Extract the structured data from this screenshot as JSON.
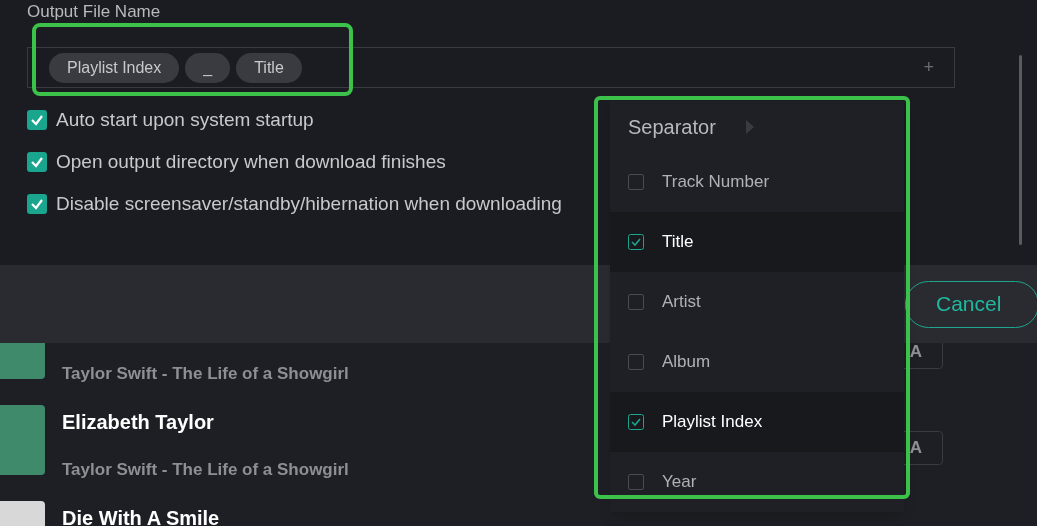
{
  "output_file_name": {
    "label": "Output File Name",
    "chips": [
      "Playlist Index",
      "_",
      "Title"
    ],
    "add_button": "+"
  },
  "options": [
    {
      "label": "Auto start upon system startup",
      "checked": true
    },
    {
      "label": "Open output directory when download finishes",
      "checked": true
    },
    {
      "label": "Disable screensaver/standby/hibernation when downloading",
      "checked": true
    }
  ],
  "cancel_button": "Cancel",
  "tracks": [
    {
      "subtitle": "Taylor Swift - The Life of a Showgirl",
      "action": "A"
    },
    {
      "title": "Elizabeth Taylor",
      "subtitle": "Taylor Swift - The Life of a Showgirl",
      "action": "A"
    },
    {
      "title": "Die With A Smile"
    }
  ],
  "dropdown": {
    "header": "Separator",
    "items": [
      {
        "label": "Track Number",
        "checked": false
      },
      {
        "label": "Title",
        "checked": true
      },
      {
        "label": "Artist",
        "checked": false
      },
      {
        "label": "Album",
        "checked": false
      },
      {
        "label": "Playlist Index",
        "checked": true
      },
      {
        "label": "Year",
        "checked": false
      }
    ]
  }
}
